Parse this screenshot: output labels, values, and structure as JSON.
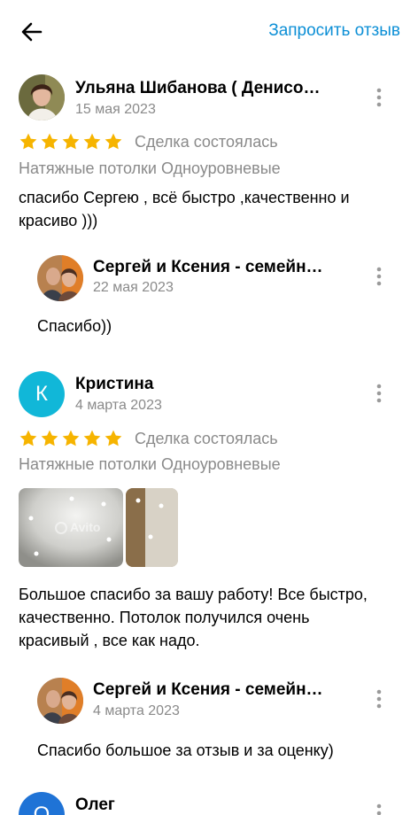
{
  "header": {
    "back_icon": "arrow-left-icon",
    "request_review_label": "Запросить отзыв"
  },
  "colors": {
    "accent": "#0c8fd6",
    "star": "#f6b400",
    "muted": "#8a8a8a",
    "avatar_k": "#11b7d8",
    "avatar_o": "#1f73d6"
  },
  "reviews": [
    {
      "author": "Ульяна Шибанова ( Денисо…",
      "date": "15 мая 2023",
      "rating": 5,
      "status": "Сделка состоялась",
      "category": "Натяжные потолки Одноуровневые",
      "text": "спасибо Сергею , всё быстро ,качественно и красиво )))",
      "reply": {
        "author": "Сергей и Ксения - семейн…",
        "date": "22 мая 2023",
        "text": "Спасибо))"
      }
    },
    {
      "author": "Кристина",
      "avatar_letter": "К",
      "date": "4 марта 2023",
      "rating": 5,
      "status": "Сделка состоялась",
      "category": "Натяжные потолки Одноуровневые",
      "photo_watermark": "Avito",
      "text": "Большое спасибо за вашу работу! Все быстро, качественно. Потолок получился очень красивый , все как надо.",
      "reply": {
        "author": "Сергей и Ксения - семейн…",
        "date": "4 марта 2023",
        "text": "Спасибо большое за отзыв и за оценку)"
      }
    },
    {
      "author": "Олег",
      "avatar_letter": "О"
    }
  ]
}
